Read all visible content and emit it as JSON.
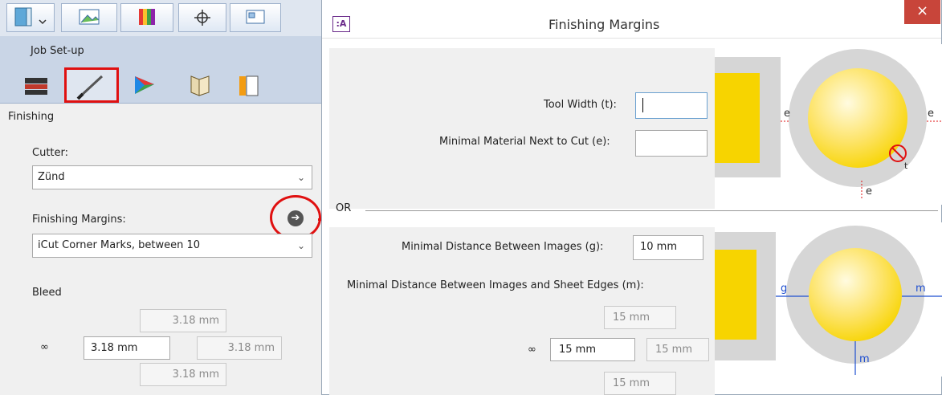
{
  "left_panel": {
    "section_title": "Job Set-up",
    "subsection_title": "Finishing",
    "cutter": {
      "label": "Cutter:",
      "value": "Zünd"
    },
    "finishing_margins": {
      "label": "Finishing Margins:",
      "value": "iCut Corner Marks, between 10"
    },
    "bleed": {
      "label": "Bleed",
      "top": "3.18 mm",
      "left": "3.18 mm",
      "right": "3.18 mm",
      "bottom": "3.18 mm"
    }
  },
  "dialog": {
    "title": "Finishing Margins",
    "close_glyph": "×",
    "app_icon_text": ":A",
    "tool_width": {
      "label": "Tool Width (t):",
      "value": ""
    },
    "min_material": {
      "label": "Minimal Material Next to Cut (e):",
      "value": ""
    },
    "or_label": "OR",
    "min_dist_images": {
      "label": "Minimal Distance Between Images (g):",
      "value": "10 mm"
    },
    "min_dist_edges": {
      "label": "Minimal Distance Between Images and Sheet Edges (m):",
      "top": "15 mm",
      "left": "15 mm",
      "right": "15 mm",
      "bottom": "15 mm"
    },
    "diagram1_labels": {
      "e_left": "e",
      "e_right": "e",
      "e_bottom": "e",
      "t": "t"
    },
    "diagram2_labels": {
      "g": "g",
      "m_right": "m",
      "m_bottom": "m"
    }
  },
  "colors": {
    "highlight_red": "#e01010",
    "tool_active": "#c9d5e6",
    "image_yellow": "#f7d400",
    "frame_gray": "#d6d6d6"
  }
}
